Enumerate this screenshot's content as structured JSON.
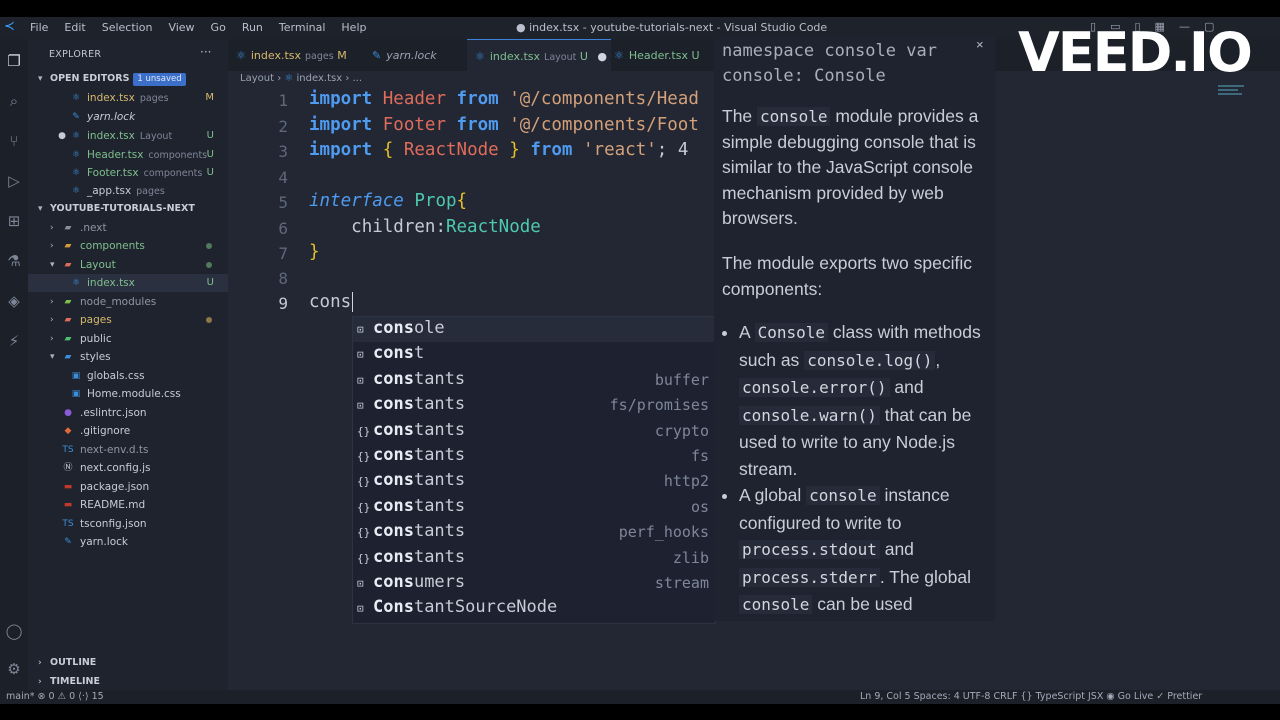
{
  "watermark": "VEED.IO",
  "titlebar": {
    "menu": [
      "File",
      "Edit",
      "Selection",
      "View",
      "Go",
      "Run",
      "Terminal",
      "Help"
    ],
    "title": "● index.tsx - youtube-tutorials-next - Visual Studio Code"
  },
  "explorer": {
    "header": "EXPLORER",
    "more": "···",
    "open_editors": {
      "label": "OPEN EDITORS",
      "badge": "1 unsaved",
      "items": [
        {
          "name": "index.tsx",
          "dir": "pages",
          "status": "M"
        },
        {
          "name": "yarn.lock",
          "dir": "",
          "status": ""
        },
        {
          "name": "index.tsx",
          "dir": "Layout",
          "status": "U"
        },
        {
          "name": "Header.tsx",
          "dir": "components",
          "status": "U"
        },
        {
          "name": "Footer.tsx",
          "dir": "components",
          "status": "U"
        },
        {
          "name": "_app.tsx",
          "dir": "pages",
          "status": ""
        }
      ]
    },
    "project": {
      "label": "YOUTUBE-TUTORIALS-NEXT",
      "items": [
        {
          "name": ".next",
          "status": ""
        },
        {
          "name": "components",
          "status": ""
        },
        {
          "name": "Layout",
          "status": ""
        },
        {
          "name": "index.tsx",
          "status": "U"
        },
        {
          "name": "node_modules",
          "status": ""
        },
        {
          "name": "pages",
          "status": ""
        },
        {
          "name": "public",
          "status": ""
        },
        {
          "name": "styles",
          "status": ""
        },
        {
          "name": "globals.css",
          "status": ""
        },
        {
          "name": "Home.module.css",
          "status": ""
        },
        {
          "name": ".eslintrc.json",
          "status": ""
        },
        {
          "name": ".gitignore",
          "status": ""
        },
        {
          "name": "next-env.d.ts",
          "status": ""
        },
        {
          "name": "next.config.js",
          "status": ""
        },
        {
          "name": "package.json",
          "status": ""
        },
        {
          "name": "README.md",
          "status": ""
        },
        {
          "name": "tsconfig.json",
          "status": ""
        },
        {
          "name": "yarn.lock",
          "status": ""
        }
      ]
    },
    "outline": "OUTLINE",
    "timeline": "TIMELINE"
  },
  "tabs": [
    {
      "name": "index.tsx",
      "dir": "pages",
      "status": "M"
    },
    {
      "name": "yarn.lock",
      "dir": "",
      "status": ""
    },
    {
      "name": "index.tsx",
      "dir": "Layout",
      "status": "U"
    },
    {
      "name": "Header.tsx",
      "dir": "",
      "status": "U"
    }
  ],
  "breadcrumb": {
    "folder": "Layout",
    "file": "index.tsx",
    "more": "..."
  },
  "editor": {
    "line_numbers": [
      "1",
      "2",
      "3",
      "4",
      "5",
      "6",
      "7",
      "8",
      "9"
    ],
    "line1": {
      "kw1": "import",
      "cls": "Header",
      "kw2": "from",
      "str": "'@/components/Head"
    },
    "line2": {
      "kw1": "import",
      "cls": "Footer",
      "kw2": "from",
      "str": "'@/components/Foot"
    },
    "line3": {
      "kw1": "import",
      "b1": "{",
      "cls": "ReactNode",
      "b2": "}",
      "kw2": "from",
      "str": "'react'",
      "semi": ";",
      "tail": "4"
    },
    "line5": {
      "kw": "interface",
      "name": "Prop",
      "brace": "{"
    },
    "line6": {
      "prop": "children:",
      "typ": "ReactNode"
    },
    "line7": {
      "brace": "}"
    },
    "line9": {
      "text": "cons"
    }
  },
  "suggestions": [
    {
      "icon": "variable-icon",
      "match": "cons",
      "rest": "ole",
      "detail": ""
    },
    {
      "icon": "keyword-icon",
      "match": "cons",
      "rest": "t",
      "detail": ""
    },
    {
      "icon": "variable-icon",
      "match": "cons",
      "rest": "tants",
      "detail": "buffer"
    },
    {
      "icon": "variable-icon",
      "match": "cons",
      "rest": "tants",
      "detail": "fs/promises"
    },
    {
      "icon": "module-icon",
      "match": "cons",
      "rest": "tants",
      "detail": "crypto"
    },
    {
      "icon": "module-icon",
      "match": "cons",
      "rest": "tants",
      "detail": "fs"
    },
    {
      "icon": "module-icon",
      "match": "cons",
      "rest": "tants",
      "detail": "http2"
    },
    {
      "icon": "module-icon",
      "match": "cons",
      "rest": "tants",
      "detail": "os"
    },
    {
      "icon": "module-icon",
      "match": "cons",
      "rest": "tants",
      "detail": "perf_hooks"
    },
    {
      "icon": "module-icon",
      "match": "cons",
      "rest": "tants",
      "detail": "zlib"
    },
    {
      "icon": "variable-icon",
      "match": "cons",
      "rest": "umers",
      "detail": "stream"
    },
    {
      "icon": "variable-icon",
      "match": "Cons",
      "rest": "tantSourceNode",
      "detail": ""
    }
  ],
  "hover": {
    "signature": "namespace console var console: Console",
    "p1_a": "The ",
    "p1_code": "console",
    "p1_b": " module provides a simple debugging console that is similar to the JavaScript console mechanism provided by web browsers.",
    "p2": "The module exports two specific components:",
    "li1_a": "A ",
    "li1_code1": "Console",
    "li1_b": " class with methods such as ",
    "li1_code2": "console.log()",
    "li1_c": ", ",
    "li1_code3": "console.error()",
    "li1_d": " and ",
    "li1_code4": "console.warn()",
    "li1_e": " that can be used to write to any Node.js stream.",
    "li2_a": "A global ",
    "li2_code1": "console",
    "li2_b": " instance configured to write to ",
    "li2_code2": "process.stdout",
    "li2_c": " and ",
    "li2_code3": "process.stderr",
    "li2_d": ". The global ",
    "li2_code4": "console",
    "li2_e": " can be used"
  },
  "statusbar": {
    "left": "main*   ⊗ 0 ⚠ 0   ⟨·⟩ 15",
    "right": "Ln 9, Col 5    Spaces: 4    UTF-8    CRLF    {} TypeScript JSX    ◉ Go Live    ✓ Prettier"
  },
  "colors": {
    "accent": "#3b82d9",
    "keyword": "#4f9bf0",
    "class": "#e06c5a",
    "string": "#d3a07a",
    "type": "#4ec9b0",
    "brace": "#e6c028"
  }
}
